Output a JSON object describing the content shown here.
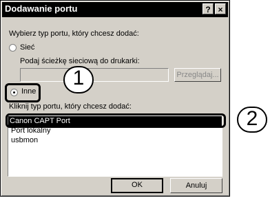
{
  "dialog": {
    "title": "Dodawanie portu",
    "help_button": "?",
    "close_button": "×",
    "prompt": "Wybierz typ portu, który chcesz dodać:",
    "network_label": "Sieć",
    "network_path_label": "Podaj ścieżkę sieciową do drukarki:",
    "browse_button": "Przeglądaj...",
    "other_label": "Inne",
    "other_prompt": "Kliknij typ portu, który chcesz dodać:",
    "ports": [
      "Canon CAPT Port",
      "Port lokalny",
      "usbmon"
    ],
    "ok_button": "OK",
    "cancel_button": "Anuluj"
  },
  "callouts": {
    "one": "1",
    "two": "2"
  }
}
